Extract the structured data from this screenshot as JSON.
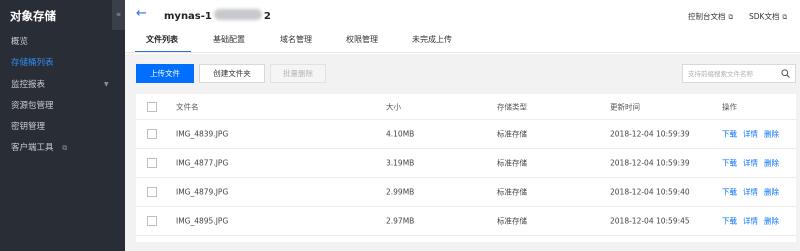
{
  "sidebar": {
    "title": "对象存储",
    "collapse_glyph": "«",
    "items": [
      {
        "label": "概览"
      },
      {
        "label": "存储桶列表",
        "active": true
      },
      {
        "label": "监控报表",
        "caret": "▼"
      },
      {
        "label": "资源包管理"
      },
      {
        "label": "密钥管理"
      },
      {
        "label": "客户端工具",
        "external": "⧉"
      }
    ]
  },
  "header": {
    "back_glyph": "←",
    "bucket_prefix": "mynas-1",
    "bucket_suffix": "2",
    "links": [
      {
        "label": "控制台文档",
        "icon": "⧉"
      },
      {
        "label": "SDK文档",
        "icon": "⧉"
      }
    ]
  },
  "tabs": [
    {
      "label": "文件列表",
      "active": true
    },
    {
      "label": "基础配置"
    },
    {
      "label": "域名管理"
    },
    {
      "label": "权限管理"
    },
    {
      "label": "未完成上传"
    }
  ],
  "toolbar": {
    "upload": "上传文件",
    "new_folder": "创建文件夹",
    "batch_delete": "批量删除",
    "search_placeholder": "支持前缀搜索文件名称"
  },
  "table": {
    "columns": [
      "文件名",
      "大小",
      "存储类型",
      "更新时间",
      "操作"
    ],
    "rows": [
      {
        "name": "IMG_4839.JPG",
        "size": "4.10MB",
        "type": "标准存储",
        "time": "2018-12-04 10:59:39"
      },
      {
        "name": "IMG_4877.JPG",
        "size": "3.19MB",
        "type": "标准存储",
        "time": "2018-12-04 10:59:39"
      },
      {
        "name": "IMG_4879.JPG",
        "size": "2.99MB",
        "type": "标准存储",
        "time": "2018-12-04 10:59:40"
      },
      {
        "name": "IMG_4895.JPG",
        "size": "2.97MB",
        "type": "标准存储",
        "time": "2018-12-04 10:59:45"
      }
    ],
    "actions": [
      "下载",
      "详情",
      "删除"
    ]
  },
  "colors": {
    "accent": "#006eff",
    "sidebar_bg": "#292d35",
    "active_nav": "#2f8cf1"
  }
}
